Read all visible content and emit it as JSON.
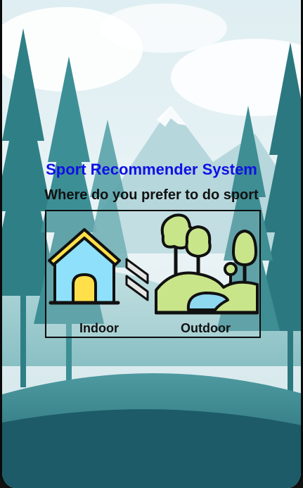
{
  "app": {
    "title": "Sport Recommender System",
    "question": "Where do you prefer to do sport"
  },
  "options": [
    {
      "label": "Indoor",
      "icon": "house-icon"
    },
    {
      "label": "Outdoor",
      "icon": "park-icon"
    }
  ],
  "colors": {
    "title": "#1010e6",
    "house_wall": "#8fe1fb",
    "house_roof": "#ffe04a",
    "house_door": "#ffe04a",
    "tree_green": "#c9e58a",
    "pond_blue": "#8ed8f0"
  }
}
